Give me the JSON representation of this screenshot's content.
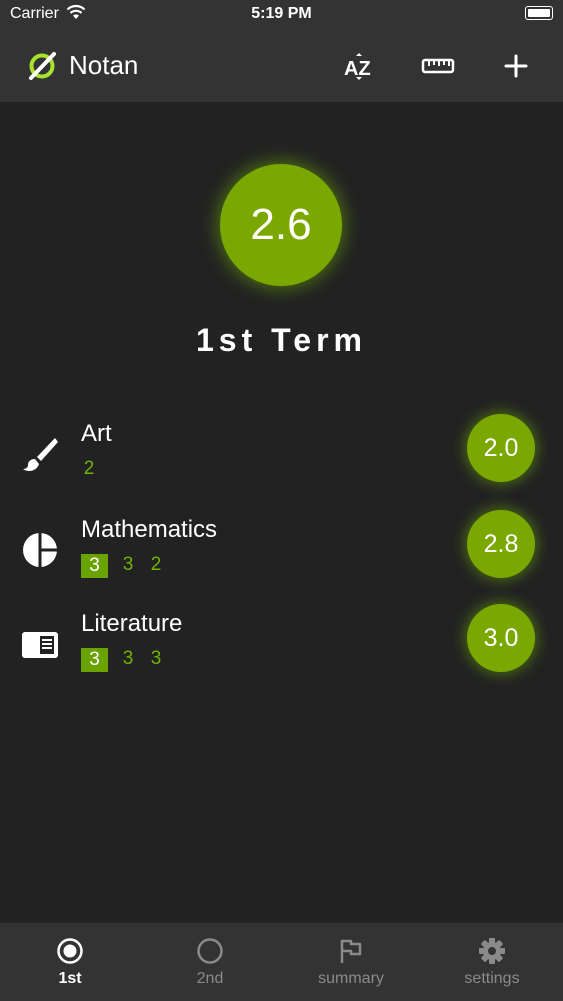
{
  "status_bar": {
    "carrier": "Carrier",
    "time": "5:19 PM"
  },
  "header": {
    "title": "Notan",
    "icons": {
      "logo": "empty-set-logo",
      "sort": "sort-az-icon",
      "ruler": "ruler-icon",
      "add": "plus-icon"
    }
  },
  "term": {
    "average": "2.6",
    "title": "1st Term"
  },
  "subjects": [
    {
      "name": "Art",
      "icon": "brush-icon",
      "grades": [
        "2"
      ],
      "average": "2.0"
    },
    {
      "name": "Mathematics",
      "icon": "pie-chart-icon",
      "grades": [
        "3",
        "3",
        "2"
      ],
      "average": "2.8"
    },
    {
      "name": "Literature",
      "icon": "book-icon",
      "grades": [
        "3",
        "3",
        "3"
      ],
      "average": "3.0"
    }
  ],
  "tabs": [
    {
      "label": "1st",
      "icon": "circle-dot-icon",
      "active": true
    },
    {
      "label": "2nd",
      "icon": "circle-icon",
      "active": false
    },
    {
      "label": "summary",
      "icon": "flag-icon",
      "active": false
    },
    {
      "label": "settings",
      "icon": "gear-icon",
      "active": false
    }
  ],
  "colors": {
    "accent": "#7aa800",
    "grade_text": "#6fb400",
    "background": "#222222",
    "bar": "#333333"
  }
}
